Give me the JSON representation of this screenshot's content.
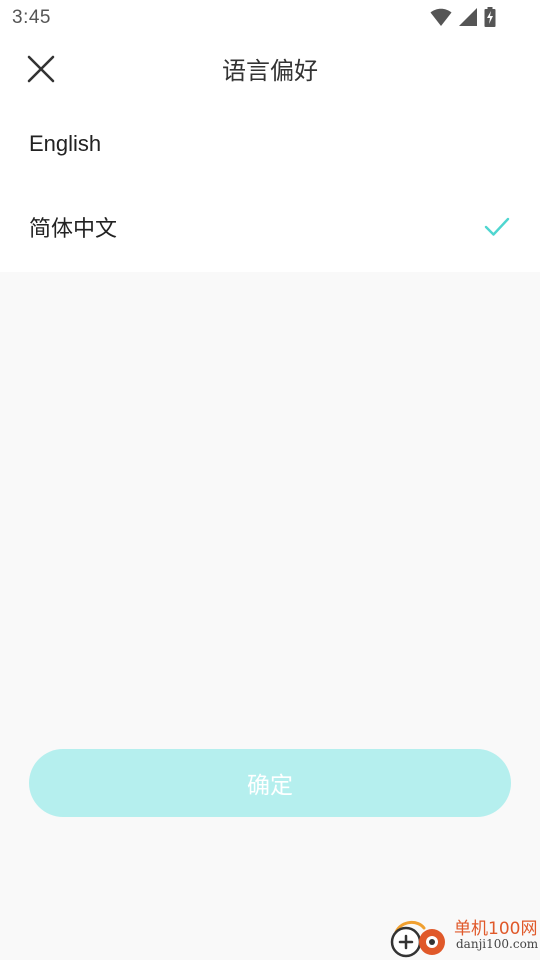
{
  "status_bar": {
    "time": "3:45",
    "icons": [
      "wifi-icon",
      "cellular-signal-icon",
      "battery-charging-icon"
    ]
  },
  "header": {
    "title": "语言偏好",
    "close_icon": "close-icon"
  },
  "languages": [
    {
      "label": "English",
      "selected": false
    },
    {
      "label": "简体中文",
      "selected": true
    }
  ],
  "confirm_button": {
    "label": "确定"
  },
  "watermark": {
    "line1": "单机100网",
    "line2": "danji100.com"
  },
  "colors": {
    "accent": "#4fd6d0",
    "button_bg": "#b5efee",
    "background": "#f9f9f9",
    "card": "#ffffff"
  }
}
